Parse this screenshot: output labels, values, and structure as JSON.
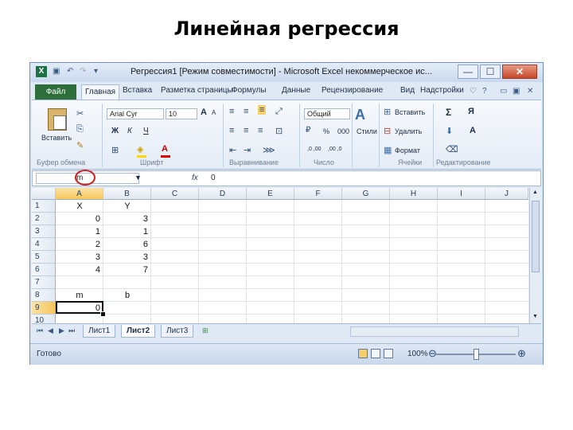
{
  "slide": {
    "title": "Линейная регрессия"
  },
  "window": {
    "title": "Регрессия1  [Режим совместимости] - Microsoft Excel некоммерческое ис...",
    "icons": [
      "excel-logo-icon",
      "save-icon",
      "undo-icon",
      "redo-icon",
      "qat-dropdown-icon",
      "minimize-icon",
      "maximize-icon",
      "close-icon"
    ],
    "min": "—",
    "max": "☐",
    "close": "✕"
  },
  "tabs": {
    "file": "Файл",
    "items": [
      "Главная",
      "Вставка",
      "Разметка страницы",
      "Формулы",
      "Данные",
      "Рецензирование",
      "Вид",
      "Надстройки"
    ],
    "active": "Главная"
  },
  "ribbon": {
    "clipboard": {
      "paste": "Вставить",
      "label": "Буфер обмена"
    },
    "font": {
      "name": "Arial Cyr",
      "size": "10",
      "bold": "Ж",
      "italic": "К",
      "underline": "Ч",
      "grow": "A",
      "shrink": "A",
      "label": "Шрифт"
    },
    "alignment": {
      "label": "Выравнивание"
    },
    "number": {
      "format": "Общий",
      "percent": "%",
      "thousands": "000",
      "currency": "₽",
      "dec_inc": ",0 ,00",
      "dec_dec": ",00 ,0",
      "label": "Число"
    },
    "styles": {
      "label_btn": "Стили"
    },
    "cells": {
      "insert": "Вставить",
      "delete": "Удалить",
      "format": "Формат",
      "label": "Ячейки"
    },
    "editing": {
      "sum": "Σ",
      "sort": "Я",
      "find": "A",
      "label": "Редактирование"
    }
  },
  "formula_bar": {
    "name_box": "m",
    "fx": "fx",
    "value": "0"
  },
  "grid": {
    "columns": [
      "A",
      "B",
      "C",
      "D",
      "E",
      "F",
      "G",
      "H",
      "I",
      "J"
    ],
    "rows": [
      "1",
      "2",
      "3",
      "4",
      "5",
      "6",
      "7",
      "8",
      "9",
      "10"
    ],
    "selected_column": "A",
    "selected_row": "9",
    "cells": {
      "A1": "X",
      "B1": "Y",
      "A2": "0",
      "B2": "3",
      "A3": "1",
      "B3": "1",
      "A4": "2",
      "B4": "6",
      "A5": "3",
      "B5": "3",
      "A6": "4",
      "B6": "7",
      "A8": "m",
      "B8": "b",
      "A9": "0"
    }
  },
  "sheets": {
    "tabs": [
      "Лист1",
      "Лист2",
      "Лист3"
    ],
    "active": "Лист2"
  },
  "status": {
    "text": "Готово",
    "zoom": "100%",
    "zoom_out": "⊖",
    "zoom_in": "⊕"
  }
}
